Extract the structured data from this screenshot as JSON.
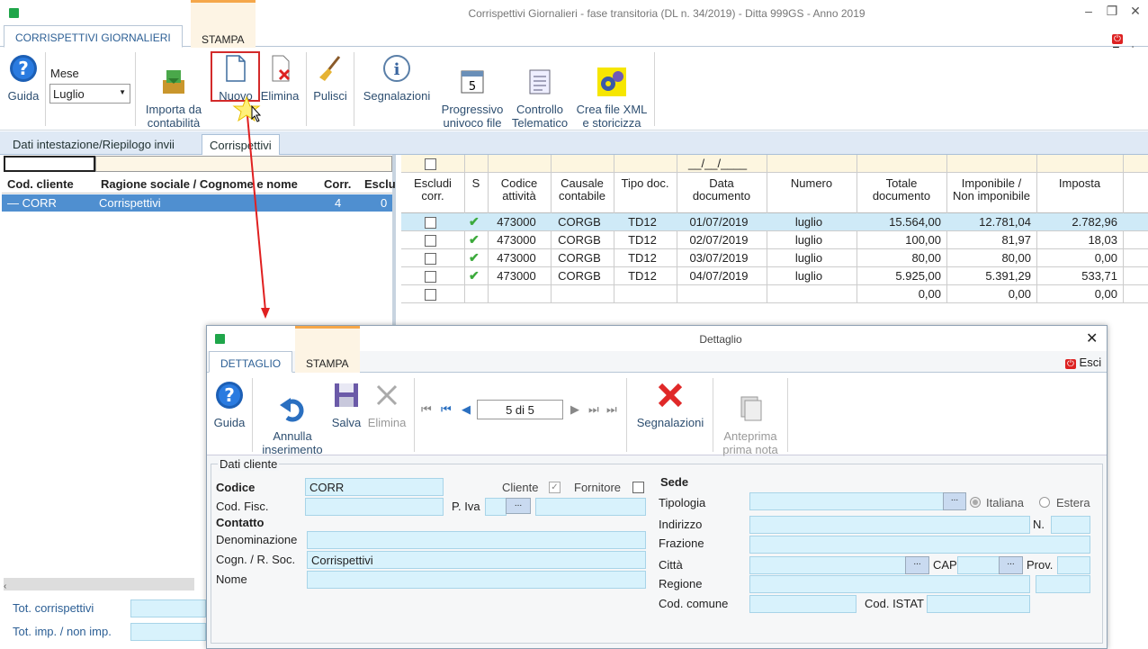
{
  "window": {
    "title": "Corrispettivi Giornalieri - fase transitoria (DL n. 34/2019) - Ditta 999GS - Anno 2019"
  },
  "tabs": [
    "CORRISPETTIVI GIORNALIERI",
    "STAMPA"
  ],
  "exit_label": "Esci",
  "ribbon": {
    "guida": "Guida",
    "mese_label": "Mese",
    "mese_value": "Luglio",
    "importa": "Importa da\ncontabilità",
    "nuovo": "Nuovo",
    "elimina": "Elimina",
    "pulisci": "Pulisci",
    "segnalazioni": "Segnalazioni",
    "progressivo": "Progressivo\nunivoco file",
    "controllo": "Controllo\nTelematico",
    "crea": "Crea file XML\ne storicizza"
  },
  "subtabs": [
    "Dati intestazione/Riepilogo invii",
    "Corrispettivi"
  ],
  "left_grid": {
    "headers": [
      "Cod. cliente",
      "Ragione sociale / Cognome e nome",
      "Corr.",
      "Esclu"
    ],
    "row": {
      "cod": "CORR",
      "ragione": "Corrispettivi",
      "corr": "4",
      "esclu": "0"
    }
  },
  "totals": {
    "tot_corr": "Tot. corrispettivi",
    "tot_imp": "Tot. imp. / non imp."
  },
  "right_grid": {
    "date_filter": "__/__/____",
    "headers": [
      "Escludi\ncorr.",
      "S",
      "Codice\nattività",
      "Causale\ncontabile",
      "Tipo doc.",
      "Data\ndocumento",
      "Numero",
      "Totale\ndocumento",
      "Imponibile /\nNon imponibile",
      "Imposta"
    ],
    "rows": [
      {
        "cod": "473000",
        "causale": "CORGB",
        "tipo": "TD12",
        "data": "01/07/2019",
        "numero": "luglio",
        "totale": "15.564,00",
        "imponibile": "12.781,04",
        "imposta": "2.782,96"
      },
      {
        "cod": "473000",
        "causale": "CORGB",
        "tipo": "TD12",
        "data": "02/07/2019",
        "numero": "luglio",
        "totale": "100,00",
        "imponibile": "81,97",
        "imposta": "18,03"
      },
      {
        "cod": "473000",
        "causale": "CORGB",
        "tipo": "TD12",
        "data": "03/07/2019",
        "numero": "luglio",
        "totale": "80,00",
        "imponibile": "80,00",
        "imposta": "0,00"
      },
      {
        "cod": "473000",
        "causale": "CORGB",
        "tipo": "TD12",
        "data": "04/07/2019",
        "numero": "luglio",
        "totale": "5.925,00",
        "imponibile": "5.391,29",
        "imposta": "533,71"
      }
    ],
    "total_row": {
      "totale": "0,00",
      "imponibile": "0,00",
      "imposta": "0,00"
    }
  },
  "dialog": {
    "title": "Dettaglio",
    "tabs": [
      "DETTAGLIO",
      "STAMPA"
    ],
    "exit": "Esci",
    "toolbar": {
      "guida": "Guida",
      "annulla": "Annulla\ninserimento",
      "salva": "Salva",
      "elimina": "Elimina",
      "nav": "5 di 5",
      "segnalazioni": "Segnalazioni",
      "anteprima": "Anteprima\nprima nota"
    },
    "section": "Dati cliente",
    "codice_label": "Codice",
    "codice": "CORR",
    "cliente": "Cliente",
    "fornitore": "Fornitore",
    "codfisc": "Cod. Fisc.",
    "piva": "P. Iva",
    "contatto": "Contatto",
    "denominazione": "Denominazione",
    "cognome_label": "Cogn. / R. Soc.",
    "cognome": "Corrispettivi",
    "nome": "Nome",
    "sede": "Sede",
    "tipologia": "Tipologia",
    "italiana": "Italiana",
    "estera": "Estera",
    "indirizzo": "Indirizzo",
    "n": "N.",
    "frazione": "Frazione",
    "citta": "Città",
    "cap": "CAP",
    "prov": "Prov.",
    "regione": "Regione",
    "comune": "Cod. comune",
    "istat": "Cod. ISTAT",
    "ellipsis": "..."
  }
}
